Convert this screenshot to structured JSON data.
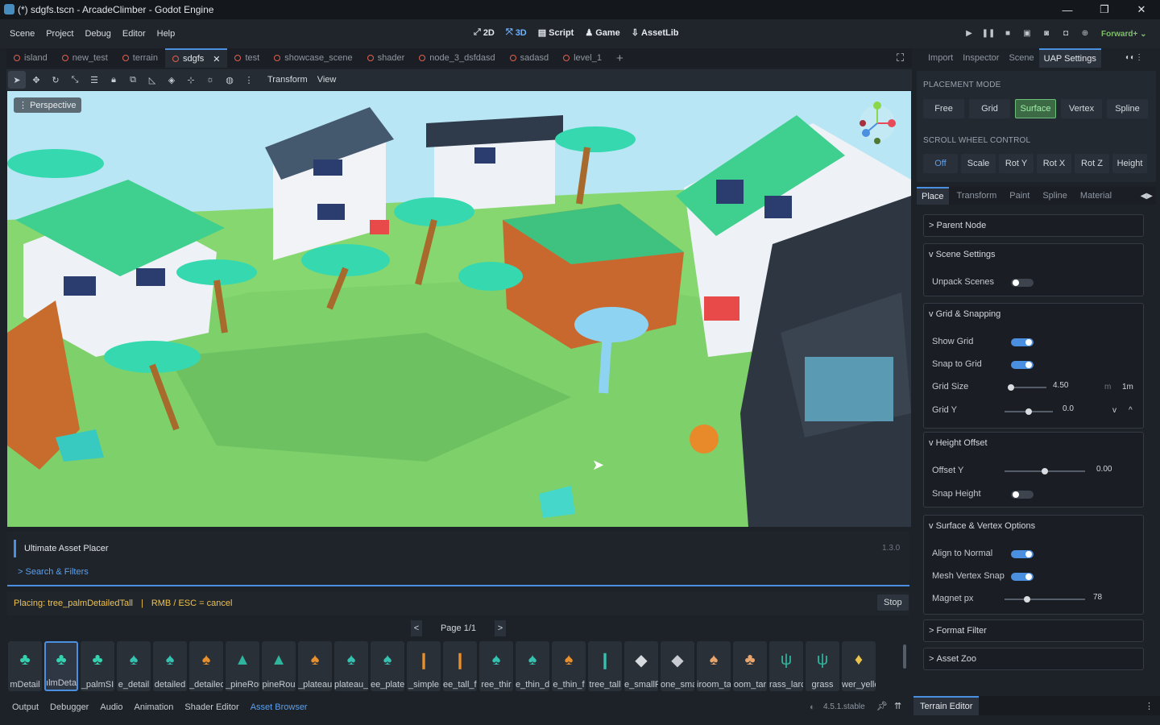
{
  "window": {
    "title": "(*) sdgfs.tscn - ArcadeClimber - Godot Engine"
  },
  "menu": [
    "Scene",
    "Project",
    "Debug",
    "Editor",
    "Help"
  ],
  "modes": {
    "m2d": "2D",
    "m3d": "3D",
    "script": "Script",
    "game": "Game",
    "assetlib": "AssetLib"
  },
  "renderer": "Forward+",
  "scene_tabs": [
    "island",
    "new_test",
    "terrain",
    "sdgfs",
    "test",
    "showcase_scene",
    "shader",
    "node_3_dsfdasd",
    "sadasd",
    "level_1"
  ],
  "active_tab": "sdgfs",
  "toolbar": {
    "transform": "Transform",
    "view": "View"
  },
  "viewport": {
    "perspective": "Perspective"
  },
  "uap": {
    "title": "Ultimate Asset Placer",
    "version": "1.3.0",
    "search": "Search & Filters"
  },
  "placing": {
    "text": "Placing: tree_palmDetailedTall",
    "sep": "|",
    "hint": "RMB / ESC = cancel",
    "stop": "Stop"
  },
  "pager": {
    "prev": "<",
    "label": "Page 1/1",
    "next": ">"
  },
  "assets": [
    "mDetail",
    "ılmDeta",
    "_palmSI",
    "e_detail",
    "detailed",
    "_detailec",
    "_pineRou",
    "pineRou",
    "_plateau",
    "plateau_",
    "ee_plate",
    "_simple",
    "ee_tall_fi",
    "ree_thir",
    "e_thin_d",
    "e_thin_f",
    "tree_tall",
    "e_smallF",
    "one_sma",
    "iroom_ta",
    "oom_tar",
    "rass_larc",
    "grass",
    "wer_yellc"
  ],
  "bottom_tabs": [
    "Output",
    "Debugger",
    "Audio",
    "Animation",
    "Shader Editor",
    "Asset Browser"
  ],
  "version": "4.5.1.stable",
  "dock_tabs": [
    "Import",
    "Inspector",
    "Scene",
    "UAP Settings"
  ],
  "placement": {
    "label": "PLACEMENT MODE",
    "options": [
      "Free",
      "Grid",
      "Surface",
      "Vertex",
      "Spline"
    ],
    "selected": "Surface"
  },
  "scroll": {
    "label": "SCROLL WHEEL CONTROL",
    "options": [
      "Off",
      "Scale",
      "Rot Y",
      "Rot X",
      "Rot Z",
      "Height"
    ],
    "selected": "Off"
  },
  "sub_tabs": [
    "Place",
    "Transform",
    "Paint",
    "Spline",
    "Material"
  ],
  "parent_node": "Parent Node",
  "scene_settings": {
    "title": "Scene Settings",
    "unpack": "Unpack Scenes",
    "unpack_on": false
  },
  "grid": {
    "title": "Grid & Snapping",
    "show_grid": "Show Grid",
    "show_grid_on": true,
    "snap_grid": "Snap to Grid",
    "snap_grid_on": true,
    "grid_size": "Grid Size",
    "grid_size_val": "4.50",
    "grid_size_unit": "m",
    "grid_size_preset": "1m",
    "grid_y": "Grid Y",
    "grid_y_val": "0.0",
    "grid_y_down": "v",
    "grid_y_up": "^"
  },
  "height": {
    "title": "Height Offset",
    "offset_y": "Offset Y",
    "offset_val": "0.00",
    "snap": "Snap Height",
    "snap_on": false
  },
  "surface": {
    "title": "Surface & Vertex Options",
    "align": "Align to Normal",
    "align_on": true,
    "mesh_snap": "Mesh Vertex Snap",
    "mesh_snap_on": true,
    "magnet": "Magnet px",
    "magnet_val": "78"
  },
  "format_filter": "Format Filter",
  "asset_zoo": "Asset Zoo",
  "terrain_editor": "Terrain Editor"
}
